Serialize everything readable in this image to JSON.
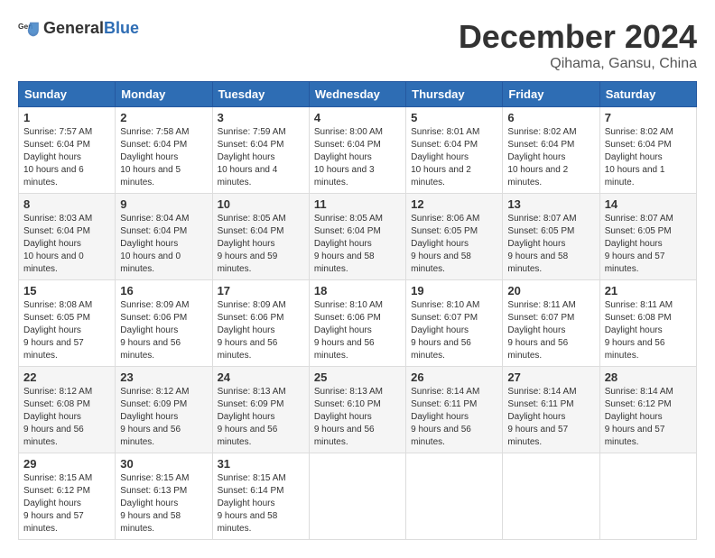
{
  "header": {
    "logo_general": "General",
    "logo_blue": "Blue",
    "month_title": "December 2024",
    "location": "Qihama, Gansu, China"
  },
  "weekdays": [
    "Sunday",
    "Monday",
    "Tuesday",
    "Wednesday",
    "Thursday",
    "Friday",
    "Saturday"
  ],
  "weeks": [
    [
      {
        "day": "1",
        "sunrise": "7:57 AM",
        "sunset": "6:04 PM",
        "daylight": "10 hours and 6 minutes."
      },
      {
        "day": "2",
        "sunrise": "7:58 AM",
        "sunset": "6:04 PM",
        "daylight": "10 hours and 5 minutes."
      },
      {
        "day": "3",
        "sunrise": "7:59 AM",
        "sunset": "6:04 PM",
        "daylight": "10 hours and 4 minutes."
      },
      {
        "day": "4",
        "sunrise": "8:00 AM",
        "sunset": "6:04 PM",
        "daylight": "10 hours and 3 minutes."
      },
      {
        "day": "5",
        "sunrise": "8:01 AM",
        "sunset": "6:04 PM",
        "daylight": "10 hours and 2 minutes."
      },
      {
        "day": "6",
        "sunrise": "8:02 AM",
        "sunset": "6:04 PM",
        "daylight": "10 hours and 2 minutes."
      },
      {
        "day": "7",
        "sunrise": "8:02 AM",
        "sunset": "6:04 PM",
        "daylight": "10 hours and 1 minute."
      }
    ],
    [
      {
        "day": "8",
        "sunrise": "8:03 AM",
        "sunset": "6:04 PM",
        "daylight": "10 hours and 0 minutes."
      },
      {
        "day": "9",
        "sunrise": "8:04 AM",
        "sunset": "6:04 PM",
        "daylight": "10 hours and 0 minutes."
      },
      {
        "day": "10",
        "sunrise": "8:05 AM",
        "sunset": "6:04 PM",
        "daylight": "9 hours and 59 minutes."
      },
      {
        "day": "11",
        "sunrise": "8:05 AM",
        "sunset": "6:04 PM",
        "daylight": "9 hours and 58 minutes."
      },
      {
        "day": "12",
        "sunrise": "8:06 AM",
        "sunset": "6:05 PM",
        "daylight": "9 hours and 58 minutes."
      },
      {
        "day": "13",
        "sunrise": "8:07 AM",
        "sunset": "6:05 PM",
        "daylight": "9 hours and 58 minutes."
      },
      {
        "day": "14",
        "sunrise": "8:07 AM",
        "sunset": "6:05 PM",
        "daylight": "9 hours and 57 minutes."
      }
    ],
    [
      {
        "day": "15",
        "sunrise": "8:08 AM",
        "sunset": "6:05 PM",
        "daylight": "9 hours and 57 minutes."
      },
      {
        "day": "16",
        "sunrise": "8:09 AM",
        "sunset": "6:06 PM",
        "daylight": "9 hours and 56 minutes."
      },
      {
        "day": "17",
        "sunrise": "8:09 AM",
        "sunset": "6:06 PM",
        "daylight": "9 hours and 56 minutes."
      },
      {
        "day": "18",
        "sunrise": "8:10 AM",
        "sunset": "6:06 PM",
        "daylight": "9 hours and 56 minutes."
      },
      {
        "day": "19",
        "sunrise": "8:10 AM",
        "sunset": "6:07 PM",
        "daylight": "9 hours and 56 minutes."
      },
      {
        "day": "20",
        "sunrise": "8:11 AM",
        "sunset": "6:07 PM",
        "daylight": "9 hours and 56 minutes."
      },
      {
        "day": "21",
        "sunrise": "8:11 AM",
        "sunset": "6:08 PM",
        "daylight": "9 hours and 56 minutes."
      }
    ],
    [
      {
        "day": "22",
        "sunrise": "8:12 AM",
        "sunset": "6:08 PM",
        "daylight": "9 hours and 56 minutes."
      },
      {
        "day": "23",
        "sunrise": "8:12 AM",
        "sunset": "6:09 PM",
        "daylight": "9 hours and 56 minutes."
      },
      {
        "day": "24",
        "sunrise": "8:13 AM",
        "sunset": "6:09 PM",
        "daylight": "9 hours and 56 minutes."
      },
      {
        "day": "25",
        "sunrise": "8:13 AM",
        "sunset": "6:10 PM",
        "daylight": "9 hours and 56 minutes."
      },
      {
        "day": "26",
        "sunrise": "8:14 AM",
        "sunset": "6:11 PM",
        "daylight": "9 hours and 56 minutes."
      },
      {
        "day": "27",
        "sunrise": "8:14 AM",
        "sunset": "6:11 PM",
        "daylight": "9 hours and 57 minutes."
      },
      {
        "day": "28",
        "sunrise": "8:14 AM",
        "sunset": "6:12 PM",
        "daylight": "9 hours and 57 minutes."
      }
    ],
    [
      {
        "day": "29",
        "sunrise": "8:15 AM",
        "sunset": "6:12 PM",
        "daylight": "9 hours and 57 minutes."
      },
      {
        "day": "30",
        "sunrise": "8:15 AM",
        "sunset": "6:13 PM",
        "daylight": "9 hours and 58 minutes."
      },
      {
        "day": "31",
        "sunrise": "8:15 AM",
        "sunset": "6:14 PM",
        "daylight": "9 hours and 58 minutes."
      },
      null,
      null,
      null,
      null
    ]
  ]
}
